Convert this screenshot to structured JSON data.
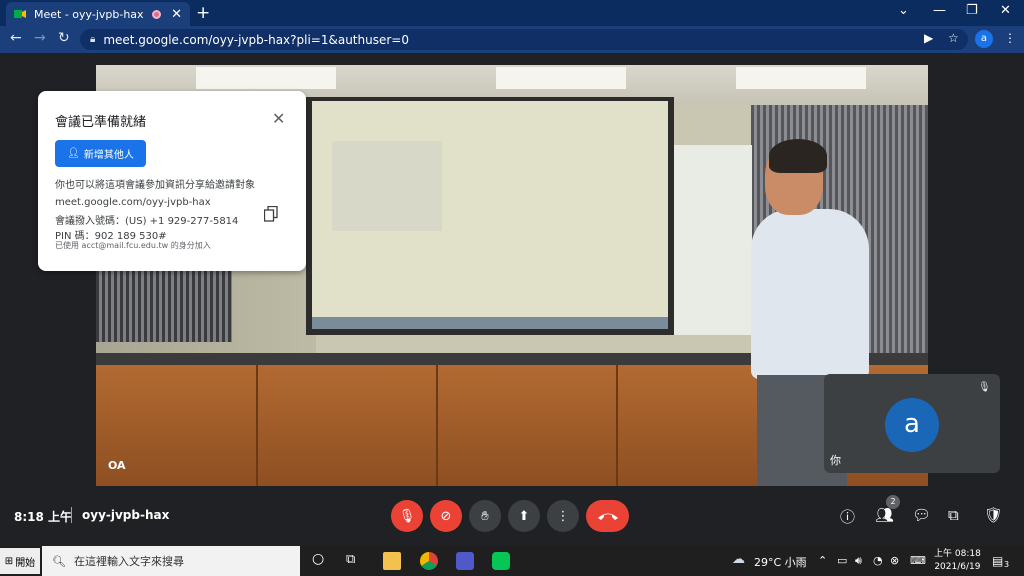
{
  "browser": {
    "tab_title": "Meet - oyy-jvpb-hax",
    "url": "meet.google.com/oyy-jvpb-hax?pli=1&authuser=0",
    "profile_initial": "a"
  },
  "video": {
    "presenter_label": "OA",
    "self_name": "你",
    "self_initial": "a"
  },
  "info_card": {
    "title": "會議已準備就緒",
    "add_button": "新增其他人",
    "description": "你也可以將這項會議參加資訊分享給邀請對象",
    "link": "meet.google.com/oyy-jvpb-hax",
    "dial_in": "會議撥入號碼：(US) +1 929-277-5814",
    "pin": "PIN 碼：902 189 530#",
    "joined_as": "已使用 acct@mail.fcu.edu.tw 的身分加入"
  },
  "meeting_bar": {
    "time": "8:18 上午",
    "meeting_code": "oyy-jvpb-hax",
    "participants_count": "2"
  },
  "taskbar": {
    "start_label": "開始",
    "search_placeholder": "在這裡輸入文字來搜尋",
    "weather": "29°C 小雨",
    "clock_time": "上午 08:18",
    "clock_date": "2021/6/19",
    "notification_count": "3"
  },
  "colors": {
    "accent": "#1a73e8",
    "danger": "#ea4335",
    "chrome_frame": "#0b2c5e",
    "meet_bg": "#202124"
  }
}
